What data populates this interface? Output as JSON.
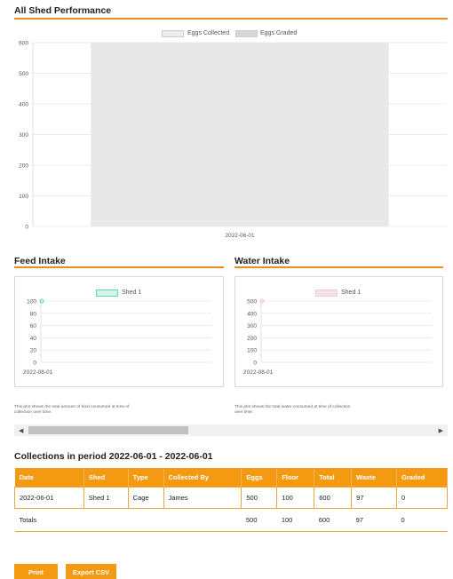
{
  "all_shed": {
    "title": "All Shed Performance",
    "legend": [
      "Eggs Collected",
      "Eggs Graded"
    ],
    "y_ticks": [
      "600",
      "500",
      "400",
      "300",
      "200",
      "100",
      "0"
    ],
    "x_label": "2022-06-01"
  },
  "feed": {
    "title": "Feed Intake",
    "legend": "Shed 1",
    "y_ticks": [
      "100",
      "80",
      "60",
      "40",
      "20",
      "0"
    ],
    "x_label": "2022-08-01",
    "note": "This plot shows the total amount of feed consumed at time of collection over time."
  },
  "water": {
    "title": "Water Intake",
    "legend": "Shed 1",
    "y_ticks": [
      "500",
      "400",
      "300",
      "200",
      "100",
      "0"
    ],
    "x_label": "2022-08-01",
    "note": "This plot shows the total water consumed at time of collection over time."
  },
  "collections": {
    "title": "Collections in period 2022-06-01 - 2022-06-01",
    "headers": [
      "Date",
      "Shed",
      "Type",
      "Collected By",
      "Eggs",
      "Floor",
      "Total",
      "Waste",
      "Graded"
    ],
    "row": [
      "2022-06-01",
      "Shed 1",
      "Cage",
      "James",
      "500",
      "100",
      "600",
      "97",
      "0"
    ],
    "totals": [
      "Totals",
      "",
      "",
      "",
      "500",
      "100",
      "600",
      "97",
      "0"
    ]
  },
  "buttons": {
    "print": "Print",
    "export": "Export CSV"
  },
  "scroll": {
    "left": "◀",
    "right": "▶"
  },
  "chart_data": [
    {
      "type": "bar",
      "categories": [
        "2022-06-01"
      ],
      "series": [
        {
          "name": "Eggs Collected",
          "values": [
            600
          ]
        },
        {
          "name": "Eggs Graded",
          "values": [
            0
          ]
        }
      ],
      "title": "All Shed Performance",
      "xlabel": "",
      "ylabel": "",
      "ylim": [
        0,
        600
      ],
      "grid": true,
      "legend": "top"
    },
    {
      "type": "line",
      "x": [
        "2022-08-01"
      ],
      "series": [
        {
          "name": "Shed 1",
          "values": [
            100
          ]
        }
      ],
      "title": "Feed Intake",
      "xlabel": "",
      "ylabel": "",
      "ylim": [
        0,
        100
      ],
      "grid": true,
      "legend": "top"
    },
    {
      "type": "line",
      "x": [
        "2022-08-01"
      ],
      "series": [
        {
          "name": "Shed 1",
          "values": [
            500
          ]
        }
      ],
      "title": "Water Intake",
      "xlabel": "",
      "ylabel": "",
      "ylim": [
        0,
        500
      ],
      "grid": true,
      "legend": "top"
    }
  ],
  "colors": {
    "accent": "#f39a12",
    "bar": "#e8e8e8",
    "feed_point": "#5fd3b0",
    "water_point": "#f3c4cf"
  }
}
